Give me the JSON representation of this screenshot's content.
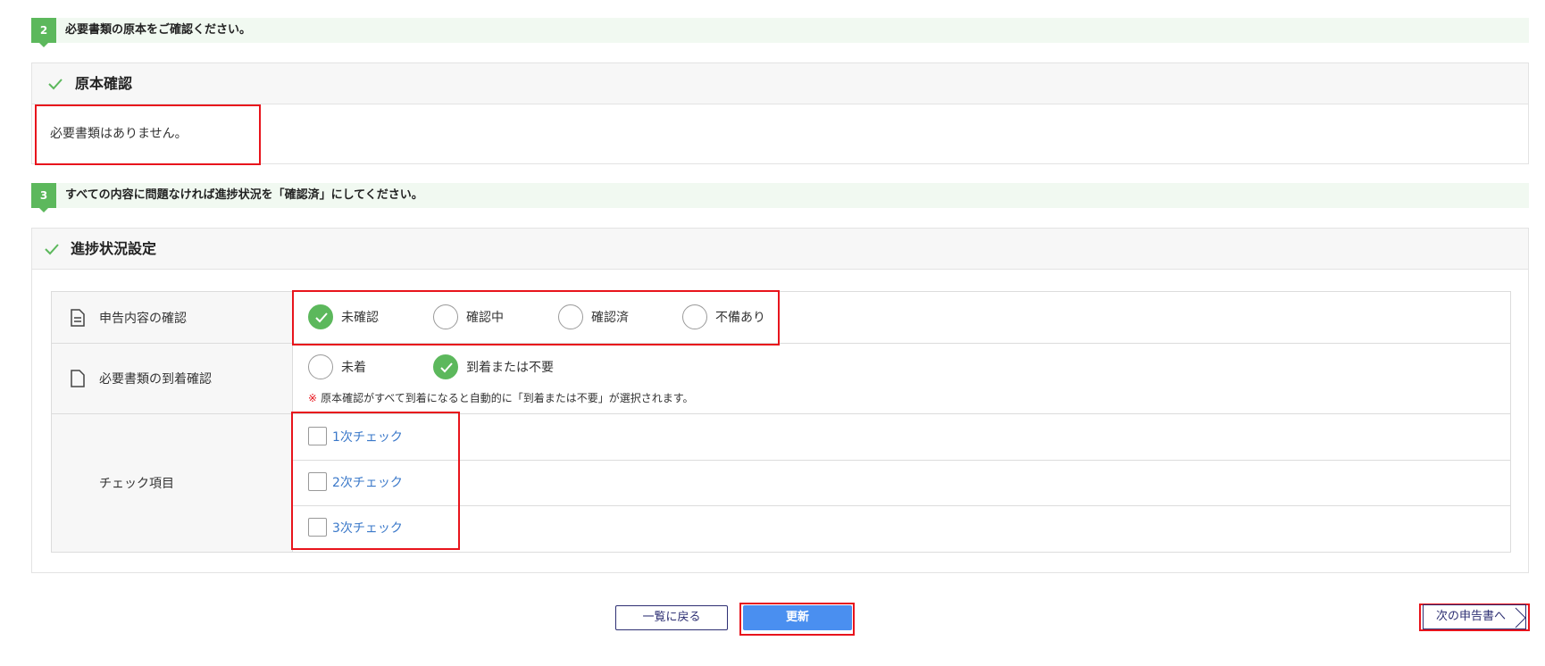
{
  "step2": {
    "number": "2",
    "text": "必要書類の原本をご確認ください。"
  },
  "original_panel": {
    "title": "原本確認",
    "message": "必要書類はありません。"
  },
  "step3": {
    "number": "3",
    "text": "すべての内容に問題なければ進捗状況を「確認済」にしてください。"
  },
  "progress_panel": {
    "title": "進捗状況設定",
    "declaration_check": {
      "label": "申告内容の確認",
      "options": [
        "未確認",
        "確認中",
        "確認済",
        "不備あり"
      ],
      "selected": "未確認"
    },
    "documents_arrival": {
      "label": "必要書類の到着確認",
      "options": [
        "未着",
        "到着または不要"
      ],
      "selected": "到着または不要",
      "note_mark": "※",
      "note": "原本確認がすべて到着になると自動的に「到着または不要」が選択されます。"
    },
    "check_items": {
      "label": "チェック項目",
      "items": [
        "1次チェック",
        "2次チェック",
        "3次チェック"
      ],
      "checked": [
        false,
        false,
        false
      ]
    }
  },
  "buttons": {
    "back": "一覧に戻る",
    "update": "更新",
    "next": "次の申告書へ"
  },
  "colors": {
    "accent_green": "#5cb85c",
    "primary_blue": "#4a8ff0",
    "highlight_red": "#e8141c",
    "link_blue": "#3a78c9"
  }
}
